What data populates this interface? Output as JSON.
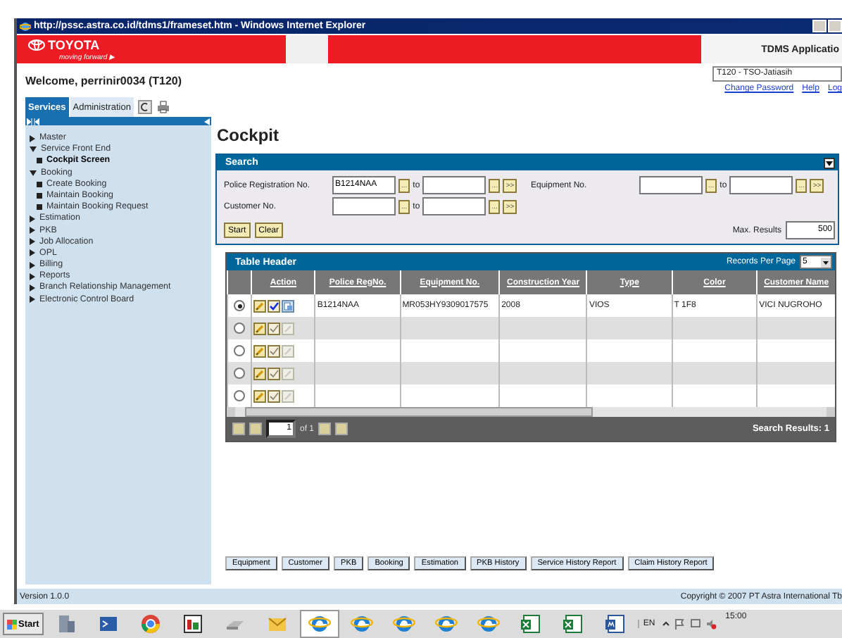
{
  "window": {
    "title": "http://pssc.astra.co.id/tdms1/frameset.htm - Windows Internet Explorer"
  },
  "header": {
    "brand": "TOYOTA",
    "tagline": "moving forward ▶",
    "app_title": "TDMS Applicatio"
  },
  "welcome": "Welcome, perrinir0034 (T120)",
  "branch": {
    "value": "T120 - TSO-Jatiasih"
  },
  "links": [
    "Change Password",
    "Help",
    "Log"
  ],
  "tabs": [
    {
      "label": "Services",
      "selected": true
    },
    {
      "label": "Administration",
      "selected": false
    }
  ],
  "sidebar": {
    "items": [
      {
        "label": "Master",
        "kind": "folder",
        "expanded": false,
        "selected": false
      },
      {
        "label": "Service Front End",
        "kind": "folder",
        "expanded": true,
        "selected": false,
        "children": [
          {
            "label": "Cockpit Screen",
            "kind": "page",
            "selected": true
          }
        ]
      },
      {
        "label": "Booking",
        "kind": "folder",
        "expanded": true,
        "selected": false,
        "children": [
          {
            "label": "Create Booking",
            "kind": "page",
            "selected": false
          },
          {
            "label": "Maintain Booking",
            "kind": "page",
            "selected": false
          },
          {
            "label": "Maintain Booking Request",
            "kind": "page",
            "selected": false
          }
        ]
      },
      {
        "label": "Estimation",
        "kind": "folder",
        "expanded": false,
        "selected": false
      },
      {
        "label": "PKB",
        "kind": "folder",
        "expanded": false,
        "selected": false
      },
      {
        "label": "Job Allocation",
        "kind": "folder",
        "expanded": false,
        "selected": false
      },
      {
        "label": "OPL",
        "kind": "folder",
        "expanded": false,
        "selected": false
      },
      {
        "label": "Billing",
        "kind": "folder",
        "expanded": false,
        "selected": false
      },
      {
        "label": "Reports",
        "kind": "folder",
        "expanded": false,
        "selected": false
      },
      {
        "label": "Branch Relationship Management",
        "kind": "folder",
        "expanded": false,
        "selected": false
      },
      {
        "label": "Electronic Control Board",
        "kind": "folder",
        "expanded": false,
        "selected": false
      }
    ]
  },
  "page_title": "Cockpit",
  "search": {
    "title": "Search",
    "fields": [
      {
        "label": "Police Registration No.",
        "from": "B1214NAA",
        "from_lookup": "...",
        "to_label": "to",
        "to_lookup": "...",
        "multi": ">>"
      },
      {
        "label": "Equipment No.",
        "from_lookup": "...",
        "to_label": "to",
        "to_lookup": "...",
        "multi": ">>"
      },
      {
        "label": "Customer No.",
        "from_lookup": "...",
        "to_label": "to",
        "to_lookup": "...",
        "multi": ">>"
      }
    ],
    "buttons": [
      "Start",
      "Clear"
    ],
    "max_results_label": "Max. Results",
    "max_results": "500"
  },
  "table": {
    "title": "Table Header",
    "records_per_page_label": "Records Per Page",
    "records_per_page": "5",
    "columns": [
      "",
      "Action",
      "Police RegNo.",
      "Equipment No.",
      "Construction Year",
      "Type",
      "Color",
      "Customer Name"
    ],
    "rows": [
      {
        "selected": true,
        "actions_enabled": true,
        "cells": [
          "",
          "",
          "B1214NAA",
          "MR053HY9309017575",
          "2008",
          "VIOS",
          "T 1F8",
          "VICI NUGROHO"
        ]
      },
      {
        "selected": false,
        "actions_enabled": false,
        "cells": []
      },
      {
        "selected": false,
        "actions_enabled": false,
        "cells": []
      },
      {
        "selected": false,
        "actions_enabled": false,
        "cells": []
      },
      {
        "selected": false,
        "actions_enabled": false,
        "cells": []
      }
    ],
    "page": "1",
    "page_of": "of 1",
    "results": "Search Results: 1"
  },
  "bottom_buttons": [
    "Equipment",
    "Customer",
    "PKB",
    "Booking",
    "Estimation",
    "PKB History",
    "Service History Report",
    "Claim History Report"
  ],
  "status_bar": {
    "version": "Version 1.0.0",
    "copyright": "Copyright © 2007 PT Astra International Tb"
  },
  "taskbar": {
    "start": "Start",
    "apps": [
      {
        "kind": "server",
        "selected": false
      },
      {
        "kind": "shell",
        "selected": false
      },
      {
        "kind": "chrome",
        "selected": false
      },
      {
        "kind": "vnc",
        "selected": false
      },
      {
        "kind": "drive",
        "selected": false
      },
      {
        "kind": "mail",
        "selected": false
      },
      {
        "kind": "browser",
        "selected": true
      },
      {
        "kind": "browser",
        "selected": false
      },
      {
        "kind": "browser",
        "selected": false
      },
      {
        "kind": "browser",
        "selected": false
      },
      {
        "kind": "browser",
        "selected": false
      },
      {
        "kind": "sheet",
        "selected": false
      },
      {
        "kind": "sheet",
        "selected": false
      },
      {
        "kind": "doc",
        "selected": false
      }
    ],
    "language": "EN",
    "time": "15:00"
  }
}
